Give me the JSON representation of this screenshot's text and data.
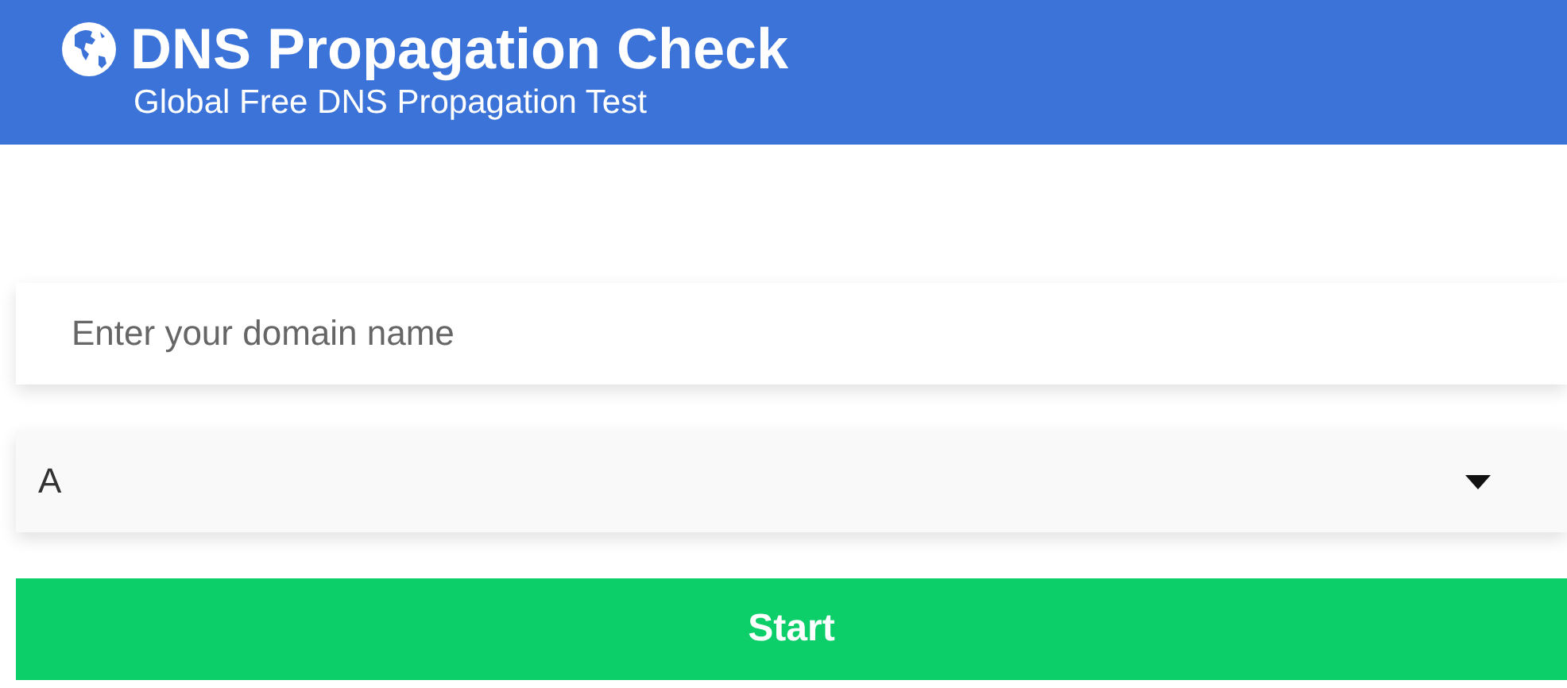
{
  "header": {
    "title": "DNS Propagation Check",
    "subtitle": "Global Free DNS Propagation Test"
  },
  "domain_field": {
    "placeholder": "Enter your domain name"
  },
  "record_type": {
    "value": "A"
  },
  "start_button": {
    "label": "Start"
  }
}
